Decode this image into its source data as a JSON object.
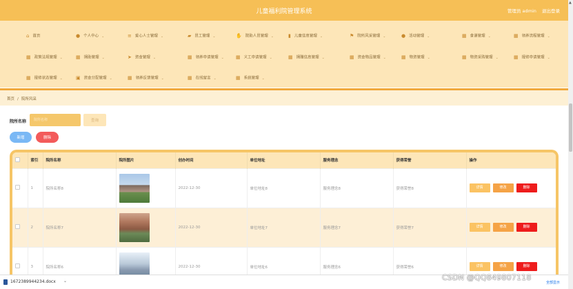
{
  "header": {
    "title": "儿童福利院管理系统",
    "user_label": "管理员 admin",
    "logout_label": "退出登录"
  },
  "nav": {
    "items": [
      {
        "label": "首页",
        "icon": "home-icon",
        "has_menu": false
      },
      {
        "label": "个人中心",
        "icon": "user-icon",
        "has_menu": true
      },
      {
        "label": "爱心人士管理",
        "icon": "sliders-icon",
        "has_menu": true
      },
      {
        "label": "员工管理",
        "icon": "chat-icon",
        "has_menu": true
      },
      {
        "label": "院助人员管理",
        "icon": "handshake-icon",
        "has_menu": true
      },
      {
        "label": "儿童信息管理",
        "icon": "book-icon",
        "has_menu": true
      },
      {
        "label": "院所风采管理",
        "icon": "flag-icon",
        "has_menu": true
      },
      {
        "label": "活动管理",
        "icon": "user-icon",
        "has_menu": true
      },
      {
        "label": "食谱管理",
        "icon": "grid-icon",
        "has_menu": true
      },
      {
        "label": "领养流程管理",
        "icon": "grid-icon",
        "has_menu": true
      },
      {
        "label": "政策法规管理",
        "icon": "grid-icon",
        "has_menu": true
      },
      {
        "label": "捐助管理",
        "icon": "grid-icon",
        "has_menu": true
      },
      {
        "label": "资金管理",
        "icon": "send-icon",
        "has_menu": true
      },
      {
        "label": "领养申请管理",
        "icon": "grid-icon",
        "has_menu": true
      },
      {
        "label": "义工申请管理",
        "icon": "grid-icon",
        "has_menu": true
      },
      {
        "label": "捐赠信息管理",
        "icon": "grid-icon",
        "has_menu": true
      },
      {
        "label": "资金物品管理",
        "icon": "grid-icon",
        "has_menu": true
      },
      {
        "label": "物资管理",
        "icon": "grid-icon",
        "has_menu": true
      },
      {
        "label": "物资采购管理",
        "icon": "grid-icon",
        "has_menu": true
      },
      {
        "label": "报修申请管理",
        "icon": "grid-icon",
        "has_menu": true
      },
      {
        "label": "报修状态管理",
        "icon": "grid-icon",
        "has_menu": true
      },
      {
        "label": "资金分配管理",
        "icon": "briefcase-icon",
        "has_menu": true
      },
      {
        "label": "领养反馈管理",
        "icon": "grid-icon",
        "has_menu": true
      },
      {
        "label": "在线留言",
        "icon": "grid-icon",
        "has_menu": true
      },
      {
        "label": "系统管理",
        "icon": "grid-icon",
        "has_menu": true
      }
    ]
  },
  "breadcrumb": {
    "home": "首页",
    "separator": "/",
    "current": "院所风采"
  },
  "search": {
    "label": "院所名称",
    "placeholder": "院所名称",
    "query_button": "查询"
  },
  "actions": {
    "add_button": "新增",
    "delete_button": "删除"
  },
  "table": {
    "columns": [
      "索引",
      "院所名称",
      "院所图片",
      "创办时间",
      "单位地址",
      "服务理念",
      "获得荣誉",
      "操作"
    ],
    "rows": [
      {
        "index": "1",
        "name": "院所名称8",
        "date": "2022-12-30",
        "address": "单位地址8",
        "philosophy": "服务理念8",
        "honors": "获得荣誉8"
      },
      {
        "index": "2",
        "name": "院所名称7",
        "date": "2022-12-30",
        "address": "单位地址7",
        "philosophy": "服务理念7",
        "honors": "获得荣誉7"
      },
      {
        "index": "3",
        "name": "院所名称6",
        "date": "2022-12-30",
        "address": "单位地址6",
        "philosophy": "服务理念6",
        "honors": "获得荣誉6"
      }
    ],
    "row_actions": {
      "detail": "详情",
      "edit": "修改",
      "remove": "删除"
    }
  },
  "downloads": {
    "filename": "1672389944234.docx",
    "show_all": "全部显示"
  },
  "watermark": "CSDN @QQ849807118",
  "colors": {
    "primary": "#f6bf56",
    "nav_bg": "#fde6b8",
    "add": "#7ab8f5",
    "delete": "#f35b5b",
    "edit": "#f5a346",
    "remove": "#ee1c1c"
  }
}
